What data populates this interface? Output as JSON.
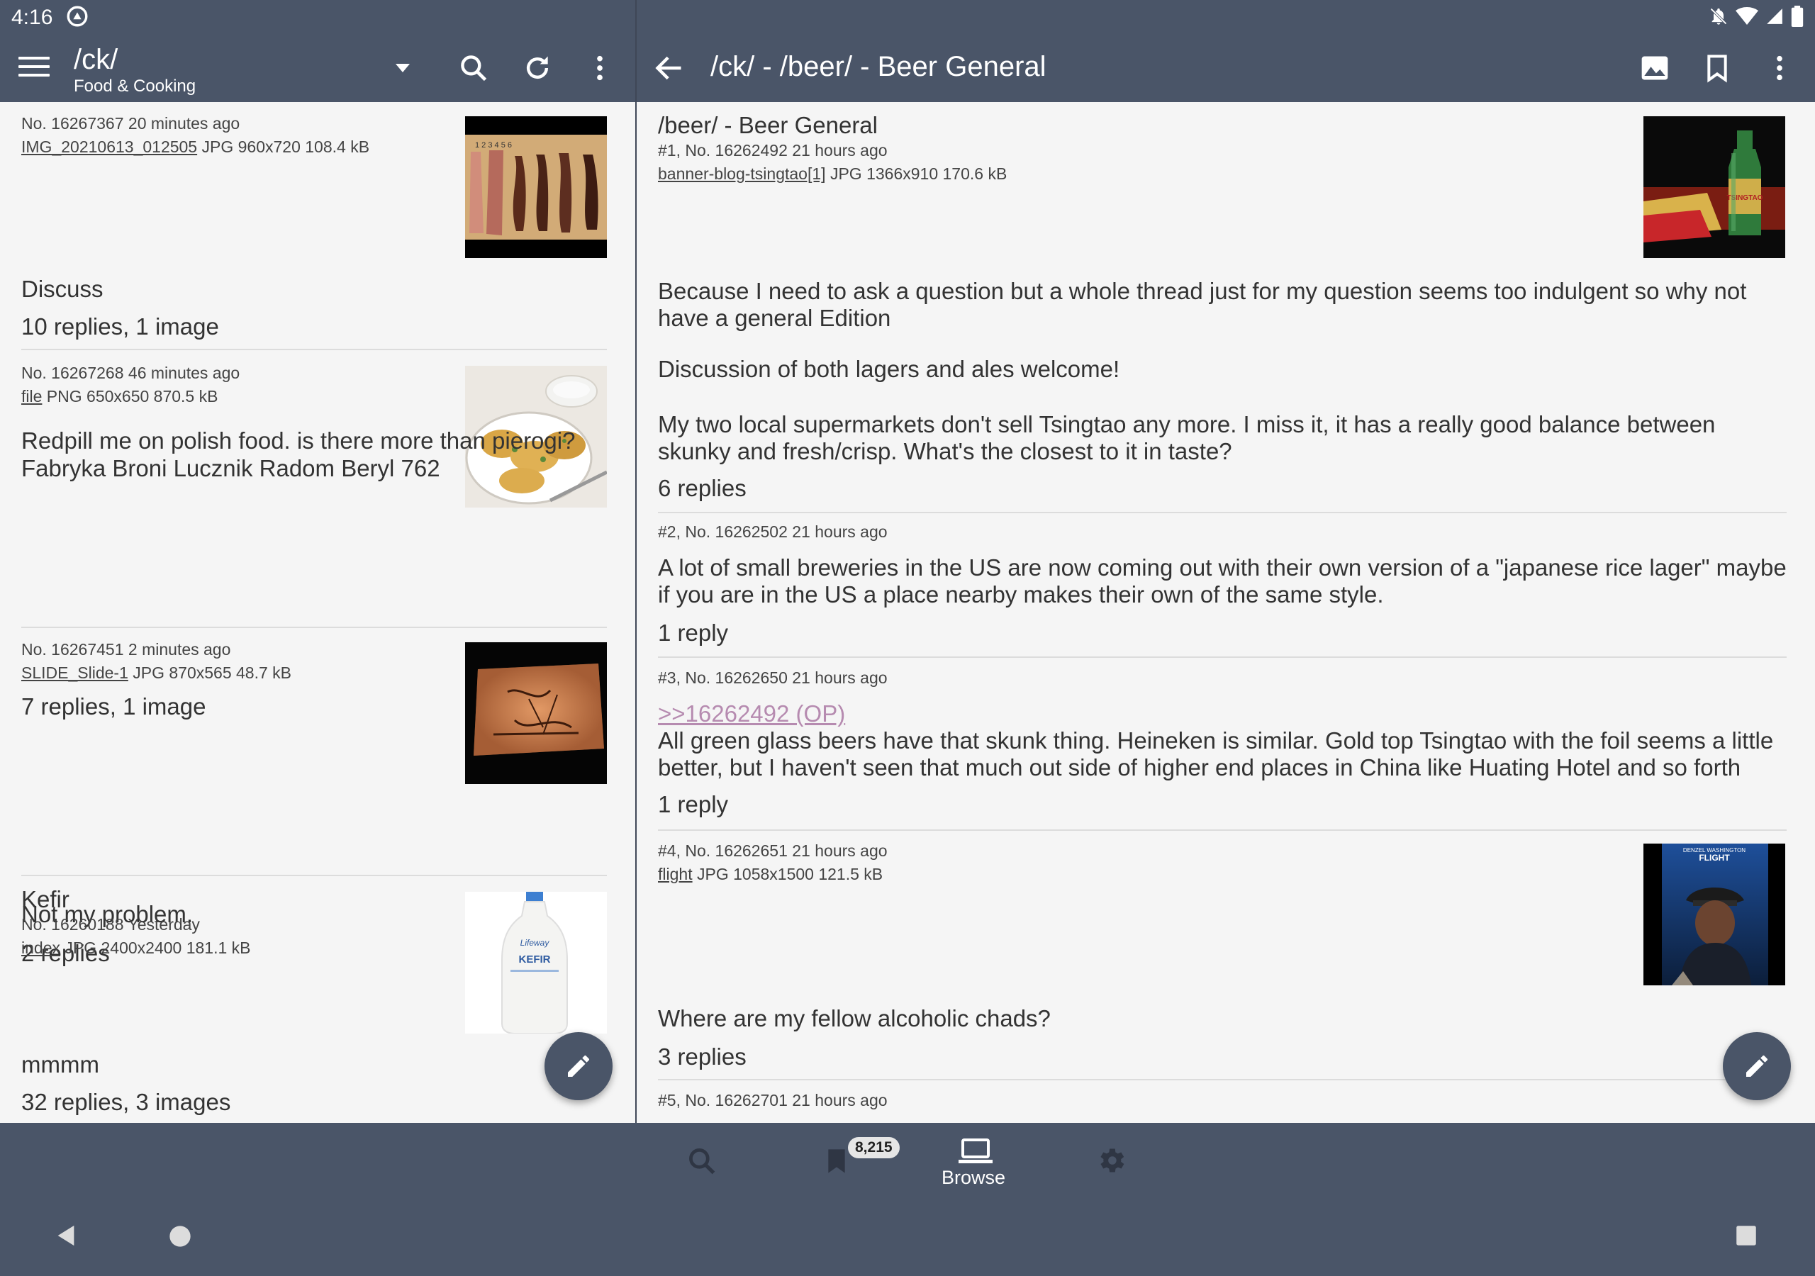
{
  "status_bar": {
    "time": "4:16"
  },
  "left_toolbar": {
    "board": "/ck/",
    "board_name": "Food & Cooking"
  },
  "right_toolbar": {
    "title": "/ck/ - /beer/ - Beer General"
  },
  "catalog": [
    {
      "meta": "No. 16267367 20 minutes ago",
      "file_name": "IMG_20210613_012505",
      "file_info": " JPG 960x720 108.4 kB",
      "subject": "",
      "comment": "Discuss",
      "replies": "10 replies, 1 image"
    },
    {
      "meta": "No. 16267268 46 minutes ago",
      "file_name": "file",
      "file_info": " PNG 650x650 870.5 kB",
      "subject": "",
      "comment": "Redpill me on polish food. is there more than pierogi?\nFabryka Broni Lucznik Radom Beryl 762",
      "replies": "7 replies, 1 image"
    },
    {
      "meta": "No. 16267451 2 minutes ago",
      "file_name": "SLIDE_Slide-1",
      "file_info": " JPG 870x565 48.7 kB",
      "subject": "",
      "comment": "Not my problem.",
      "replies": "2 replies"
    },
    {
      "meta": "No. 16260188 Yesterday",
      "file_name": "index",
      "file_info": " JPG 2400x2400 181.1 kB",
      "subject": "Kefir",
      "comment": "mmmm",
      "replies": "32 replies, 3 images"
    }
  ],
  "thread": {
    "op": {
      "subject": "/beer/ - Beer General",
      "meta": "#1, No. 16262492 21 hours ago",
      "file_name": "banner-blog-tsingtao[1]",
      "file_info": " JPG 1366x910 170.6 kB",
      "p1": "Because I need to ask a question but a whole thread just for my question seems too indulgent so why not have a general Edition",
      "p2": "Discussion of both lagers and ales welcome!",
      "p3": "My two local supermarkets don't sell Tsingtao any more. I miss it, it has a really good balance between skunky and fresh/crisp. What's the closest to it in taste?",
      "replies": "6 replies"
    },
    "posts": [
      {
        "meta": "#2, No. 16262502 21 hours ago",
        "text": "A lot of small breweries in the US are now coming out with their own version of a \"japanese rice lager\" maybe if you are in the US a place nearby makes their own of the same style.",
        "replies": "1 reply"
      },
      {
        "meta": "#3, No. 16262650 21 hours ago",
        "quote": ">>16262492 (OP)",
        "text": "All green glass beers have that skunk thing. Heineken is similar. Gold top Tsingtao with the foil seems a little better, but I haven't seen that much out side of higher end places in China like Huating Hotel and so forth",
        "replies": "1 reply"
      },
      {
        "meta": "#4, No. 16262651 21 hours ago",
        "file_name": "flight",
        "file_info": " JPG 1058x1500 121.5 kB",
        "text": "Where are my fellow alcoholic chads?",
        "replies": "3 replies"
      },
      {
        "meta": "#5, No. 16262701 21 hours ago"
      }
    ]
  },
  "bottom_nav": {
    "bookmark_badge": "8,215",
    "browse_label": "Browse"
  },
  "thumb_text": {
    "ruler": "1  2  3  4  5  6",
    "kefir_brand": "Lifeway",
    "kefir_label": "KEFIR",
    "flight_actor": "DENZEL WASHINGTON",
    "flight_title": "FLIGHT",
    "beer_label": "TSINGTAO"
  },
  "colors": {
    "toolbar": "#4a5568",
    "background": "#f5f5f5",
    "quote_link": "#b68bb0"
  }
}
